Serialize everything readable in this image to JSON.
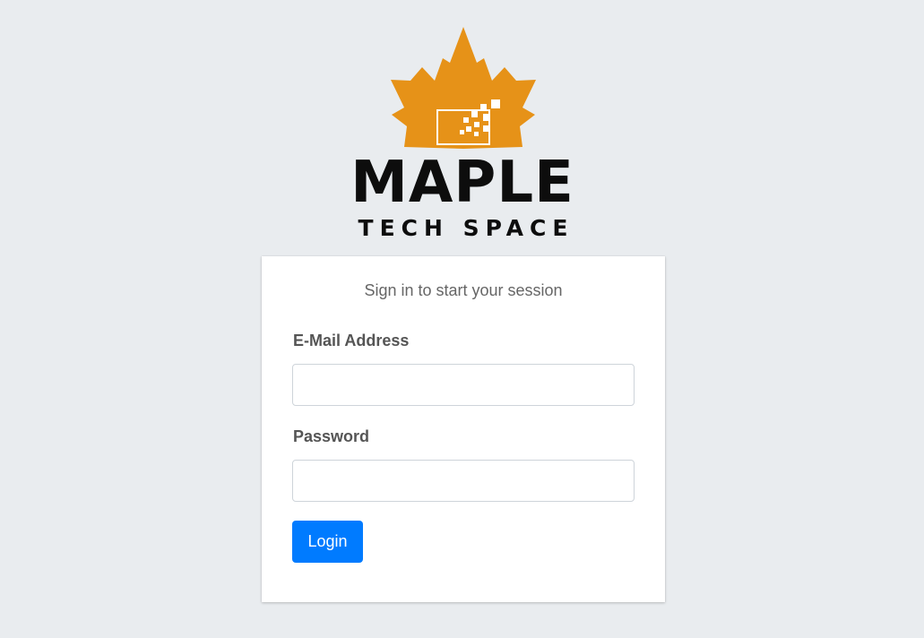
{
  "brand": {
    "logo_icon": "maple-leaf-icon",
    "name_line1": "MAPLE",
    "name_line2": "TECH SPACE",
    "leaf_color": "#E69218"
  },
  "login_card": {
    "title": "Sign in to start your session",
    "email_label": "E-Mail Address",
    "email_value": "",
    "password_label": "Password",
    "password_value": "",
    "login_button": "Login",
    "accent_color": "#007bff"
  }
}
